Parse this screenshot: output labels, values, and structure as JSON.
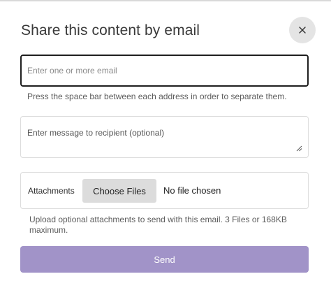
{
  "dialog": {
    "title": "Share this content by email",
    "close_icon": "close-icon",
    "close_glyph": "×"
  },
  "email": {
    "placeholder": "Enter one or more email",
    "value": "",
    "help": "Press the space bar between each address in order to separate them."
  },
  "message": {
    "placeholder": "Enter message to recipient (optional)",
    "value": "",
    "resize_icon": "resize-handle-icon"
  },
  "attachments": {
    "label": "Attachments",
    "button_label": "Choose Files",
    "status": "No file chosen",
    "help": "Upload optional attachments to send with this email. 3 Files or 168KB maximum."
  },
  "actions": {
    "send_label": "Send"
  },
  "colors": {
    "send_button": "#a193c8",
    "email_border": "#1f1f1f",
    "close_bg": "#e4e4e4",
    "choose_files_bg": "#dcdcdc"
  }
}
